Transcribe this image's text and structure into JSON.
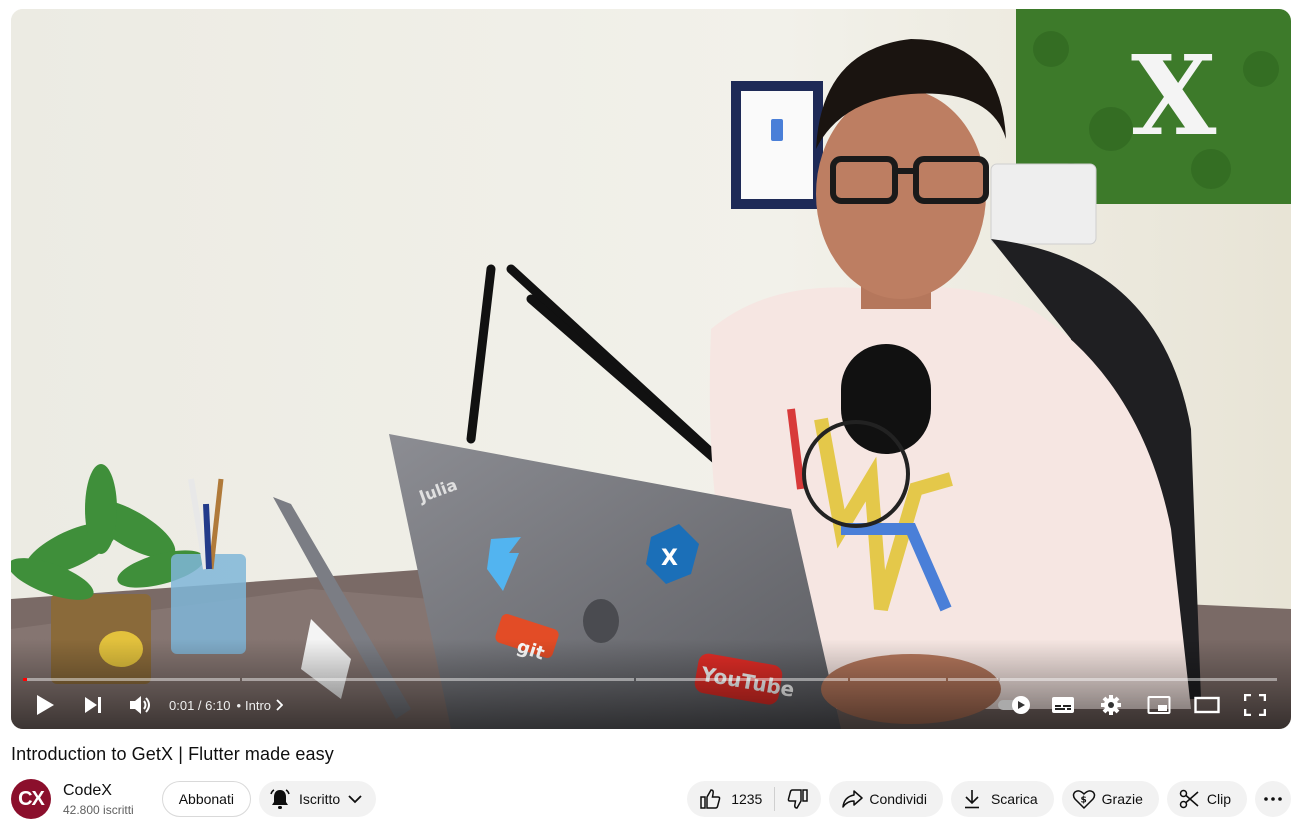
{
  "video": {
    "time_display": "0:01 / 6:10",
    "chapter_separator": "•",
    "chapter_label": "Intro",
    "progress_fraction": 0.003,
    "chapters_fraction": [
      0.172,
      0.31,
      0.166,
      0.076,
      0.04,
      0.221
    ]
  },
  "title": "Introduction to GetX | Flutter made easy",
  "channel": {
    "avatar_text": "CX",
    "name": "CodeX",
    "subscribers": "42.800 iscritti",
    "subscribe_label": "Abbonati",
    "subscribed_label": "Iscritto"
  },
  "actions": {
    "like_count": "1235",
    "share_label": "Condividi",
    "download_label": "Scarica",
    "thanks_label": "Grazie",
    "clip_label": "Clip"
  },
  "colors": {
    "progress_played": "#ff0000",
    "avatar_bg": "#8b0f2c",
    "pill_bg": "#f2f2f2"
  },
  "icons": [
    "play-icon",
    "next-icon",
    "volume-icon",
    "chevron-right-icon",
    "autoplay-toggle-icon",
    "subtitles-icon",
    "settings-icon",
    "miniplayer-icon",
    "theater-mode-icon",
    "fullscreen-icon",
    "bell-icon",
    "chevron-down-icon",
    "like-icon",
    "dislike-icon",
    "share-icon",
    "download-icon",
    "thanks-icon",
    "clip-icon",
    "more-icon"
  ]
}
